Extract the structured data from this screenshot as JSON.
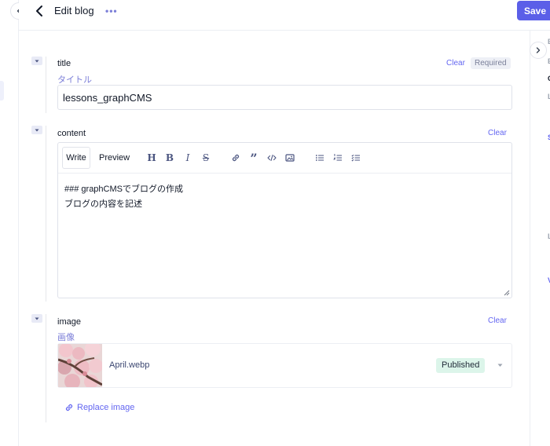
{
  "header": {
    "title": "Edit blog",
    "more": "•••",
    "save_label": "Save"
  },
  "right_panel_peek": [
    "E",
    "E",
    "C",
    "L",
    "S",
    "L",
    "V"
  ],
  "fields": {
    "title": {
      "label": "title",
      "sublabel": "タイトル",
      "clear_label": "Clear",
      "required_label": "Required",
      "value": "lessons_graphCMS"
    },
    "content": {
      "label": "content",
      "clear_label": "Clear",
      "tabs": {
        "write": "Write",
        "preview": "Preview"
      },
      "toolbar_icons": [
        "heading-icon",
        "bold-icon",
        "italic-icon",
        "strikethrough-icon",
        "link-icon",
        "quote-icon",
        "code-icon",
        "image-icon",
        "bulleted-list-icon",
        "numbered-list-icon",
        "checklist-icon"
      ],
      "lines": [
        "### graphCMSでブログの作成",
        "ブログの内容を記述"
      ]
    },
    "image": {
      "label": "image",
      "sublabel": "画像",
      "clear_label": "Clear",
      "asset_name": "April.webp",
      "status": "Published",
      "replace_label": "Replace image"
    }
  },
  "colors": {
    "accent": "#5b5fe8",
    "link": "#6366f1",
    "published_bg": "#dcf5ea",
    "required_bg": "#eef0f6"
  }
}
